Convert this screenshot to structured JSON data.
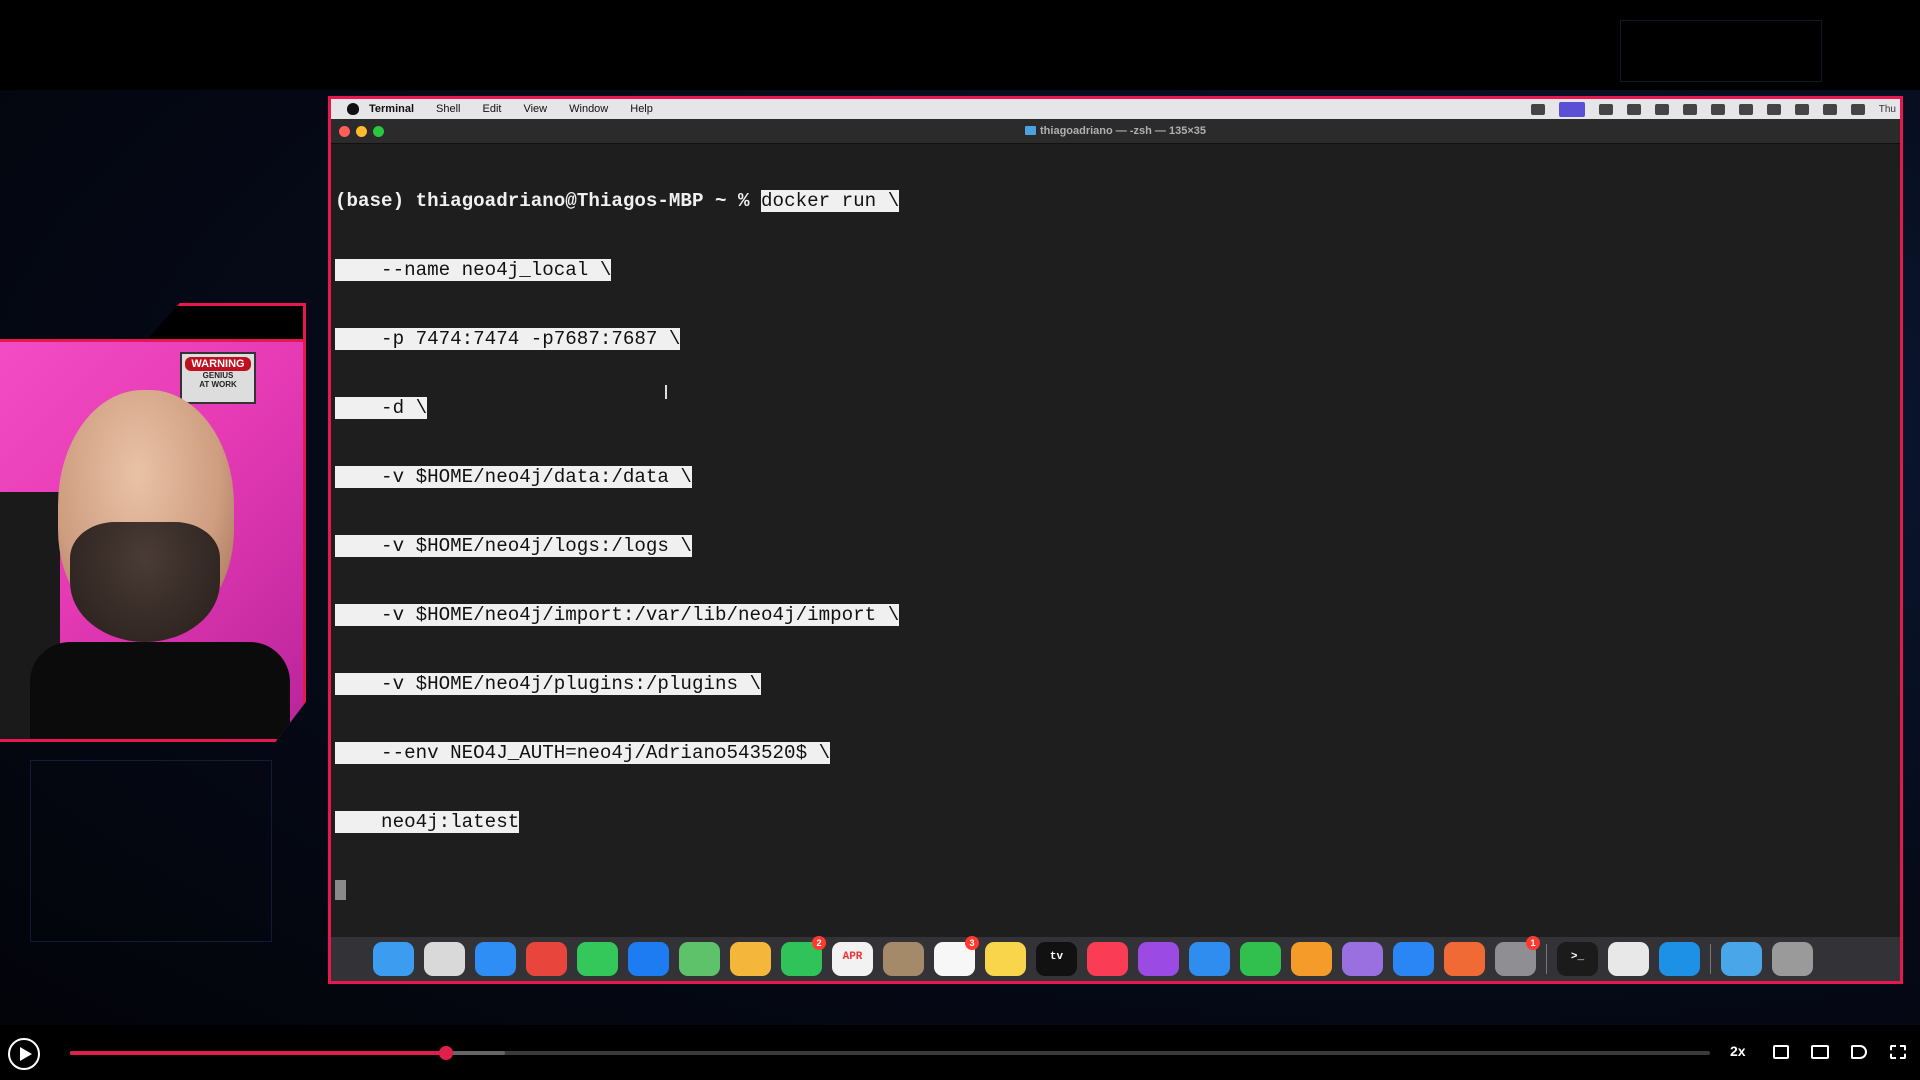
{
  "terminal": {
    "menu": {
      "app": "Terminal",
      "items": [
        "Shell",
        "Edit",
        "View",
        "Window",
        "Help"
      ],
      "clock": "Thu"
    },
    "window_title": "thiagoadriano — -zsh — 135×35",
    "prompt": "(base) thiagoadriano@Thiagos-MBP ~ % ",
    "command_lines": [
      "docker run \\",
      "    --name neo4j_local \\",
      "    -p 7474:7474 -p7687:7687 \\",
      "    -d \\",
      "    -v $HOME/neo4j/data:/data \\",
      "    -v $HOME/neo4j/logs:/logs \\",
      "    -v $HOME/neo4j/import:/var/lib/neo4j/import \\",
      "    -v $HOME/neo4j/plugins:/plugins \\",
      "    --env NEO4J_AUTH=neo4j/Adriano543520$ \\",
      "    neo4j:latest"
    ]
  },
  "webcam": {
    "poster_warning": "WARNING",
    "poster_line1": "GENIUS",
    "poster_line2": "AT WORK"
  },
  "dock": {
    "apps": [
      {
        "name": "finder",
        "color": "#3b9cf0"
      },
      {
        "name": "launchpad",
        "color": "#d9d9d9"
      },
      {
        "name": "safari",
        "color": "#2e8ef5"
      },
      {
        "name": "chrome",
        "color": "#e8453c"
      },
      {
        "name": "messages",
        "color": "#34c759"
      },
      {
        "name": "mail",
        "color": "#1e7cf2"
      },
      {
        "name": "maps",
        "color": "#5ec26a"
      },
      {
        "name": "photos",
        "color": "#f4b73c"
      },
      {
        "name": "facetime",
        "color": "#30c35a",
        "badge": "2"
      },
      {
        "name": "calendar",
        "color": "#f2f2f2",
        "label": "APR"
      },
      {
        "name": "contacts",
        "color": "#a58a6a"
      },
      {
        "name": "reminders",
        "color": "#f7f7f7",
        "badge": "3"
      },
      {
        "name": "notes",
        "color": "#f8d54a"
      },
      {
        "name": "apple-tv",
        "color": "#111111",
        "label": "tv"
      },
      {
        "name": "music",
        "color": "#fa3c55"
      },
      {
        "name": "podcasts",
        "color": "#9b4ae3"
      },
      {
        "name": "keynote",
        "color": "#2f8df0"
      },
      {
        "name": "numbers",
        "color": "#31c04d"
      },
      {
        "name": "pages",
        "color": "#f49b2a"
      },
      {
        "name": "feather",
        "color": "#9a70e0"
      },
      {
        "name": "app-store",
        "color": "#2a86f5"
      },
      {
        "name": "pencil",
        "color": "#f06a35"
      },
      {
        "name": "system-settings",
        "color": "#8e8e93",
        "badge": "1"
      },
      {
        "name": "terminal",
        "color": "#1b1b1b",
        "label": ">_"
      },
      {
        "name": "preview",
        "color": "#e8e8e8"
      },
      {
        "name": "docker",
        "color": "#1d91e6"
      },
      {
        "name": "folder",
        "color": "#49a6e8"
      },
      {
        "name": "trash",
        "color": "#9a9a9a"
      }
    ]
  },
  "player": {
    "progress": 0.229,
    "buffered": 0.265,
    "speed": "2x"
  },
  "colors": {
    "accent": "#e8184f",
    "terminal_bg": "#1e1e1e",
    "selection": "#f0f0f0"
  }
}
